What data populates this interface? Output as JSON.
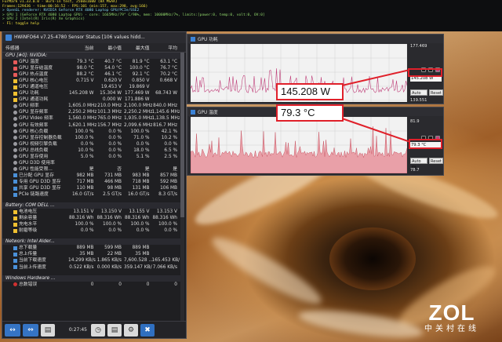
{
  "overlay": {
    "lines": [
      "FurMark v1.33.0.0 - Burn-in test, 2560x1600 (8X MSAA)",
      "Frames:129436 - time:00:16:52 - FPS:101 (min:157, max:298, avg:166)",
      "> OpenGL renderer: NVIDIA GeForce RTX 4080 Laptop GPU/PCIe/SSE2",
      "> GPU 1 (GeForce RTX 4080 Laptop GPU) - core: 1665MHz/79° C/98%, mem: 10000MHz/7%, limits:[power:0, temp:0, volt:0, OV:0]",
      "> GPU 2 (Intel(R) Iris(R) Xe Graphics)",
      "- F1: toggle help"
    ]
  },
  "hwinfo": {
    "title": "HWiNFO64 v7.25-4780 Sensor Status [106 values hidd...",
    "columns": [
      "传感器",
      "当前",
      "最小值",
      "最大值",
      "平均"
    ],
    "rows": [
      {
        "kind": "group",
        "name": "GPU [#0]: NVIDIA:"
      },
      {
        "kind": "sensor",
        "icon": "thermometer-icon",
        "name": "GPU 温度",
        "cur": "79.3 °C",
        "min": "40.7 °C",
        "max": "81.9 °C",
        "avg": "63.1 °C"
      },
      {
        "kind": "sensor",
        "icon": "thermometer-icon",
        "name": "GPU 显存结温度",
        "cur": "98.0 °C",
        "min": "54.0 °C",
        "max": "100.0 °C",
        "avg": "76.7 °C"
      },
      {
        "kind": "sensor",
        "icon": "thermometer-icon",
        "name": "GPU 热点温度",
        "cur": "88.2 °C",
        "min": "46.1 °C",
        "max": "92.1 °C",
        "avg": "70.2 °C"
      },
      {
        "kind": "sensor",
        "icon": "lightning-icon",
        "name": "GPU 核心电压",
        "cur": "0.715 V",
        "min": "0.620 V",
        "max": "0.850 V",
        "avg": "0.668 V"
      },
      {
        "kind": "sensor",
        "icon": "lightning-icon",
        "name": "GPU 通道电压",
        "cur": "",
        "min": "19.453 V",
        "max": "19.869 V",
        "avg": ""
      },
      {
        "kind": "sensor",
        "icon": "lightning-icon",
        "name": "GPU 功耗",
        "cur": "145.208 W",
        "min": "15.304 W",
        "max": "177.469 W",
        "avg": "68.743 W"
      },
      {
        "kind": "sensor",
        "icon": "lightning-icon",
        "name": "GPU 通道功耗",
        "cur": "",
        "min": "0.000 W",
        "max": "171.886 W",
        "avg": ""
      },
      {
        "kind": "sensor",
        "icon": "clock-icon",
        "name": "GPU 频率",
        "cur": "1,605.0 MHz",
        "min": "210.0 MHz",
        "max": "2,100.0 MHz",
        "avg": "840.0 MHz"
      },
      {
        "kind": "sensor",
        "icon": "clock-icon",
        "name": "GPU 显存频率",
        "cur": "2,250.2 MHz",
        "min": "101.3 MHz",
        "max": "2,250.2 MHz",
        "avg": "1,145.6 MHz"
      },
      {
        "kind": "sensor",
        "icon": "clock-icon",
        "name": "GPU Video 频率",
        "cur": "1,560.0 MHz",
        "min": "765.0 MHz",
        "max": "1,935.0 MHz",
        "avg": "1,138.5 MHz"
      },
      {
        "kind": "sensor",
        "icon": "clock-icon",
        "name": "GPU 有效频率",
        "cur": "1,620.1 MHz",
        "min": "156.7 MHz",
        "max": "2,099.6 MHz",
        "avg": "816.7 MHz"
      },
      {
        "kind": "sensor",
        "icon": "circle-icon",
        "name": "GPU 核心负载",
        "cur": "100.0 %",
        "min": "0.0 %",
        "max": "100.0 %",
        "avg": "42.1 %"
      },
      {
        "kind": "sensor",
        "icon": "circle-icon",
        "name": "GPU 显存控制器负载",
        "cur": "100.0 %",
        "min": "0.0 %",
        "max": "71.0 %",
        "avg": "10.2 %"
      },
      {
        "kind": "sensor",
        "icon": "circle-icon",
        "name": "GPU 视频引擎负载",
        "cur": "0.0 %",
        "min": "0.0 %",
        "max": "0.0 %",
        "avg": "0.0 %"
      },
      {
        "kind": "sensor",
        "icon": "circle-icon",
        "name": "GPU 总线负载",
        "cur": "10.0 %",
        "min": "0.0 %",
        "max": "18.0 %",
        "avg": "6.5 %"
      },
      {
        "kind": "sensor",
        "icon": "circle-icon",
        "name": "GPU 显存使用",
        "cur": "5.0 %",
        "min": "0.0 %",
        "max": "5.1 %",
        "avg": "2.5 %"
      },
      {
        "kind": "sensor",
        "icon": "circle-icon",
        "name": "GPU D3D 使用率",
        "cur": "",
        "min": "",
        "max": "",
        "avg": ""
      },
      {
        "kind": "sensor",
        "icon": "circle-icon",
        "name": "GPU 性能受限...",
        "cur": "是",
        "min": "否",
        "max": "是",
        "avg": "是"
      },
      {
        "kind": "sensor",
        "icon": "chip-icon",
        "name": "已分配 GPU 显存",
        "cur": "982 MB",
        "min": "731 MB",
        "max": "983 MB",
        "avg": "857 MB"
      },
      {
        "kind": "sensor",
        "icon": "chip-icon",
        "name": "专用 GPU D3D 显存",
        "cur": "717 MB",
        "min": "466 MB",
        "max": "718 MB",
        "avg": "592 MB"
      },
      {
        "kind": "sensor",
        "icon": "chip-icon",
        "name": "共享 GPU D3D 显存",
        "cur": "110 MB",
        "min": "98 MB",
        "max": "131 MB",
        "avg": "106 MB"
      },
      {
        "kind": "sensor",
        "icon": "chip-icon",
        "name": "PCIe 链路速度",
        "cur": "16.0 GT/s",
        "min": "2.5 GT/s",
        "max": "16.0 GT/s",
        "avg": "8.3 GT/s"
      },
      {
        "kind": "gap"
      },
      {
        "kind": "group",
        "name": "Battery: COM DELL ..."
      },
      {
        "kind": "sensor",
        "icon": "lightning-icon",
        "name": "电池电压",
        "cur": "13.151 V",
        "min": "13.150 V",
        "max": "13.155 V",
        "avg": "13.153 V"
      },
      {
        "kind": "sensor",
        "icon": "battery-icon",
        "name": "剩余容量",
        "cur": "88.316 Wh",
        "min": "88.316 Wh",
        "max": "88.316 Wh",
        "avg": "88.316 Wh"
      },
      {
        "kind": "sensor",
        "icon": "battery-icon",
        "name": "充电水平",
        "cur": "100.0 %",
        "min": "100.0 %",
        "max": "100.0 %",
        "avg": "100.0 %"
      },
      {
        "kind": "sensor",
        "icon": "battery-icon",
        "name": "耐磨等级",
        "cur": "0.0 %",
        "min": "0.0 %",
        "max": "0.0 %",
        "avg": "0.0 %"
      },
      {
        "kind": "gap"
      },
      {
        "kind": "group",
        "name": "Network: Intel Alder..."
      },
      {
        "kind": "sensor",
        "icon": "network-icon",
        "name": "总下载量",
        "cur": "889 MB",
        "min": "599 MB",
        "max": "889 MB",
        "avg": ""
      },
      {
        "kind": "sensor",
        "icon": "network-icon",
        "name": "总上传量",
        "cur": "35 MB",
        "min": "22 MB",
        "max": "35 MB",
        "avg": ""
      },
      {
        "kind": "sensor",
        "icon": "network-icon",
        "name": "当前下载速度",
        "cur": "14.299 KB/s",
        "min": "1.865 KB/s",
        "max": "7,600.528 ...",
        "avg": "165.453 KB/s"
      },
      {
        "kind": "sensor",
        "icon": "network-icon",
        "name": "当前上传速度",
        "cur": "0.522 KB/s",
        "min": "0.000 KB/s",
        "max": "359.147 KB/s",
        "avg": "7.066 KB/s"
      },
      {
        "kind": "gap"
      },
      {
        "kind": "group",
        "name": "Windows Hardware ..."
      },
      {
        "kind": "sensor",
        "icon": "error-icon",
        "name": "总数错误",
        "cur": "0",
        "min": "0",
        "max": "0",
        "avg": "0"
      }
    ],
    "elapsed": "0:27:45"
  },
  "power_window": {
    "title": "GPU 功耗",
    "max_label": "177.469",
    "min_label": "139.551",
    "current_label": "145.208 W",
    "callout": "145.208 W",
    "auto_fit": "Auto Fit",
    "reset": "Reset",
    "line_color": "#c0407a"
  },
  "temp_window": {
    "title": "GPU 温度",
    "max_label": "81.9",
    "min_label": "78.7",
    "current_label": "79.3 °C",
    "callout": "79.3 °C",
    "auto_fit": "Auto Fit",
    "reset": "Reset",
    "fill_color": "#e9a0a8",
    "line_color": "#c04050"
  },
  "watermark": {
    "logo": "ZOL",
    "sub": "中关村在线"
  }
}
